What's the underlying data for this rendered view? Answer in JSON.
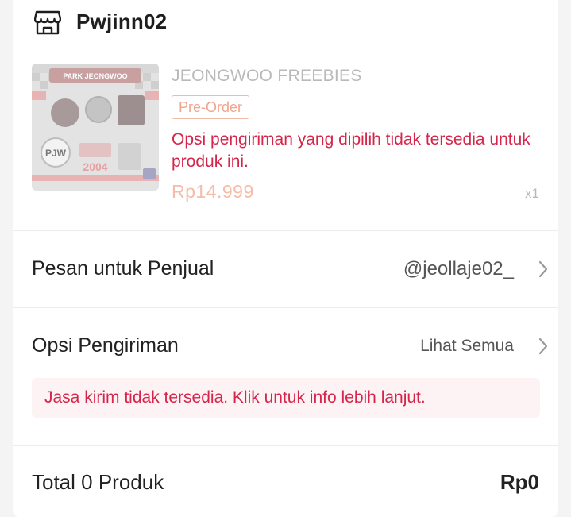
{
  "shop": {
    "name": "Pwjinn02",
    "icon": "store-icon"
  },
  "product": {
    "name": "JEONGWOO FREEBIES",
    "badge": "Pre-Order",
    "warning": "Opsi pengiriman yang dipilih tidak tersedia untuk produk ini.",
    "price": "Rp14.999",
    "quantity": "x1",
    "thumbnail_texts": {
      "title": "PARK JEONGWOO",
      "year": "2004",
      "tag": "PJW"
    }
  },
  "seller_message": {
    "label": "Pesan untuk Penjual",
    "value": "@jeollaje02_"
  },
  "shipping": {
    "label": "Opsi Pengiriman",
    "value": "Lihat Semua",
    "notice": "Jasa kirim tidak tersedia. Klik untuk info lebih lanjut."
  },
  "total": {
    "label": "Total 0 Produk",
    "value": "Rp0"
  },
  "colors": {
    "error": "#d6254a",
    "price_faded": "#f6bca9",
    "badge_border": "#f2b8a8",
    "notice_bg": "#fdf3f4"
  }
}
